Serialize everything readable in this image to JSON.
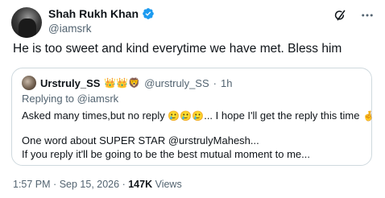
{
  "author": {
    "display_name": "Shah Rukh Khan",
    "handle": "@iamsrk",
    "verified_color": "#1d9bf0"
  },
  "tweet": {
    "text": "He is too sweet and kind everytime we have met. Bless him"
  },
  "top_actions": {
    "grok_icon": "grok-icon",
    "more_icon": "more-icon"
  },
  "quoted": {
    "display_name": "Urstruly_SS",
    "badges": "👑👑🦁",
    "handle": "@urstruly_SS",
    "separator": "·",
    "age": "1h",
    "replying_prefix": "Replying to",
    "replying_to": "@iamsrk",
    "line1_a": "Asked many times,but no reply",
    "line1_emoji": "🥲🥲🥲",
    "line1_b": "... I hope I'll get the reply this time",
    "line1_emoji2": "🤞",
    "line2": "One word about SUPER STAR @urstrulyMahesh...",
    "line3": "If you reply it'll be going to be the best mutual moment to me..."
  },
  "meta": {
    "time": "1:57 PM",
    "sep1": "·",
    "date": "Sep 15, 2026",
    "sep2": "·",
    "views_count": "147K",
    "views_label": "Views"
  }
}
